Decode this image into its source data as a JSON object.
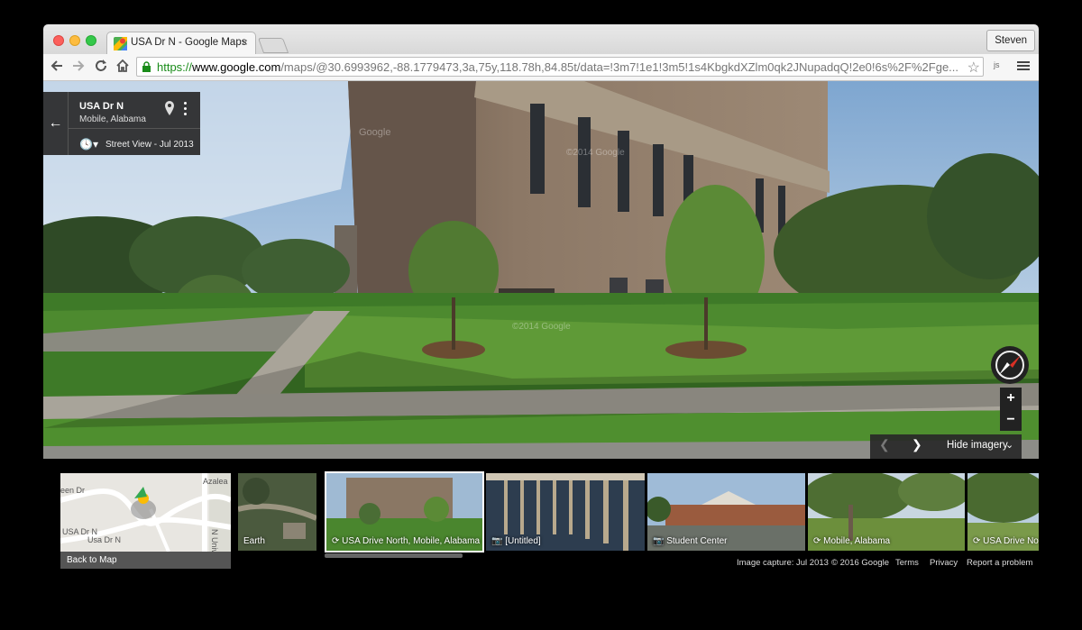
{
  "browser": {
    "tab_title": "USA Dr N - Google Maps",
    "tab_close": "×",
    "profile": "Steven",
    "url_scheme": "https://",
    "url_domain": "www.google.com",
    "url_path": "/maps/@30.6993962,-88.1779473,3a,75y,118.78h,84.85t/data=!3m7!1e1!3m5!1s4KbgkdXZlm0qk2JNupadqQ!2e0!6s%2F%2Fge...",
    "ext_label": "js"
  },
  "streetview": {
    "title": "USA Dr N",
    "subtitle": "Mobile, Alabama",
    "date_label": "Street View - Jul 2013",
    "hide_imagery": "Hide imagery",
    "zoom_in": "+",
    "zoom_out": "−"
  },
  "map_thumb": {
    "back_label": "Back to Map",
    "roads": [
      "Azalea",
      "een Dr",
      "USA Dr N",
      "Usa Dr N",
      "N Univ"
    ]
  },
  "thumbnails": [
    {
      "label": "Earth",
      "icon": "none"
    },
    {
      "label": "USA Drive North, Mobile, Alabama",
      "icon": "360-icon"
    },
    {
      "label": "[Untitled]",
      "icon": "camera-icon"
    },
    {
      "label": "Student Center",
      "icon": "camera-icon"
    },
    {
      "label": "Mobile, Alabama",
      "icon": "360-icon"
    },
    {
      "label": "USA Drive No",
      "icon": "360-icon"
    }
  ],
  "footer": {
    "capture": "Image capture: Jul 2013",
    "copyright": "© 2016 Google",
    "terms": "Terms",
    "privacy": "Privacy",
    "report": "Report a problem"
  },
  "watermarks": [
    "Google",
    "©2014 Google",
    "©2014 Google"
  ],
  "colors": {
    "https_green": "#1a8c1a",
    "compass_red": "#d93025"
  }
}
